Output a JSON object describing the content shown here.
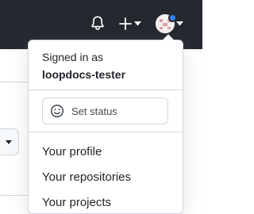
{
  "header": {
    "icons": [
      "bell-icon",
      "plus-icon",
      "caret-down-icon",
      "avatar",
      "notification-indicator"
    ],
    "colors": {
      "background": "#24292f",
      "notification_dot": "#2f81f7"
    }
  },
  "dropdown": {
    "signed_in_label": "Signed in as",
    "username": "loopdocs-tester",
    "set_status_label": "Set status",
    "items": [
      {
        "label": "Your profile"
      },
      {
        "label": "Your repositories"
      },
      {
        "label": "Your projects"
      }
    ]
  }
}
